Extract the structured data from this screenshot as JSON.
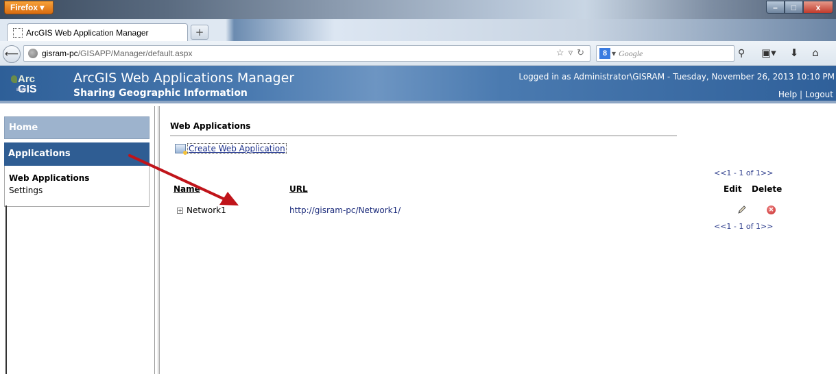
{
  "browser": {
    "menu_button": "Firefox",
    "tab_title": "ArcGIS Web Application Manager",
    "new_tab": "+",
    "url_host": "gisram-pc",
    "url_path": "/GISAPP/Manager/default.aspx",
    "search_placeholder": "Google",
    "window_controls": {
      "minimize": "–",
      "maximize": "□",
      "close": "x"
    }
  },
  "header": {
    "logo_arc": "Arc",
    "logo_gis": "GIS",
    "logo_esri": "ESRI",
    "title": "ArcGIS Web Applications Manager",
    "subtitle": "Sharing Geographic Information",
    "logged_in": "Logged in as Administrator\\GISRAM - Tuesday, November 26, 2013 10:10 PM",
    "help": "Help",
    "separator": "|",
    "logout": "Logout"
  },
  "sidebar": {
    "home": "Home",
    "applications": "Applications",
    "sub_items": [
      "Web Applications",
      "Settings"
    ]
  },
  "main": {
    "section_title": "Web Applications",
    "create_link": "Create Web Application",
    "pager_top": "<<1 - 1 of 1>>",
    "pager_bottom": "<<1 - 1 of 1>>",
    "columns": {
      "name": "Name",
      "url": "URL",
      "edit": "Edit",
      "delete": "Delete"
    },
    "rows": [
      {
        "name": "Network1",
        "url": "http://gisram-pc/Network1/"
      }
    ]
  },
  "colors": {
    "banner_blue": "#2e5f98",
    "sidebar_active": "#2f5d93",
    "sidebar_home": "#9db3cd",
    "annotation_arrow": "#c0141a"
  }
}
